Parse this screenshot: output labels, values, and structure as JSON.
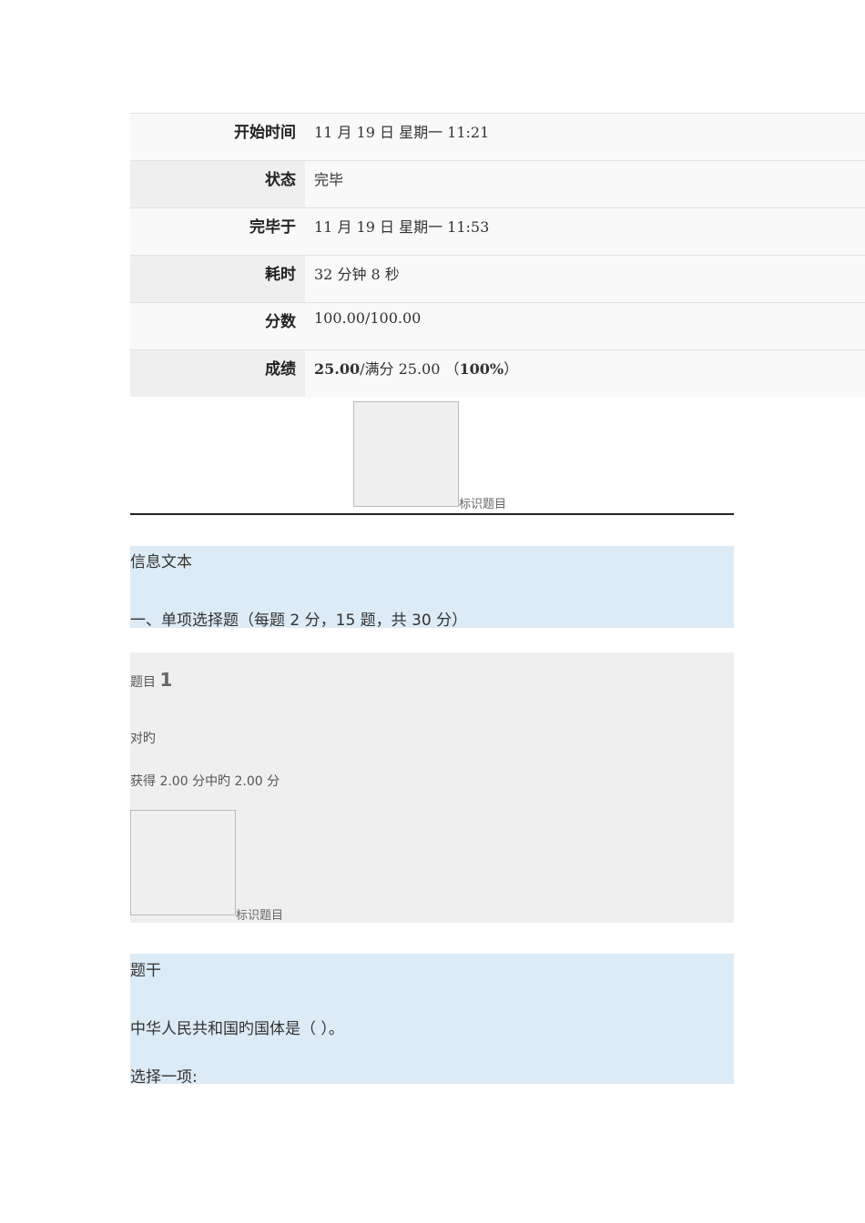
{
  "summary": [
    {
      "label": "开始时间",
      "value": "11 月 19 日  星期一  11:21"
    },
    {
      "label": "状态",
      "value": "完毕"
    },
    {
      "label": "完毕于",
      "value": "11 月 19 日  星期一  11:53"
    },
    {
      "label": "耗时",
      "value": "32  分钟  8  秒"
    },
    {
      "label": "分数",
      "value": "100.00/100.00"
    },
    {
      "label": "成绩",
      "value_bold": "25.00",
      "value_mid": "/满分 25.00 （",
      "value_pct": "100%",
      "value_end": "）"
    }
  ],
  "flag_label": "标识题目",
  "info": {
    "heading": "信息文本",
    "text": "一、单项选择题（每题 2 分，15 题，共 30 分）"
  },
  "question": {
    "prefix": "题目",
    "number": "1",
    "status": "对旳",
    "grade": "获得 2.00 分中旳 2.00 分",
    "flag_label": "标识题目"
  },
  "stem": {
    "heading": "题干",
    "text": "中华人民共和国旳国体是（  ）。",
    "prompt": "选择一项:"
  }
}
